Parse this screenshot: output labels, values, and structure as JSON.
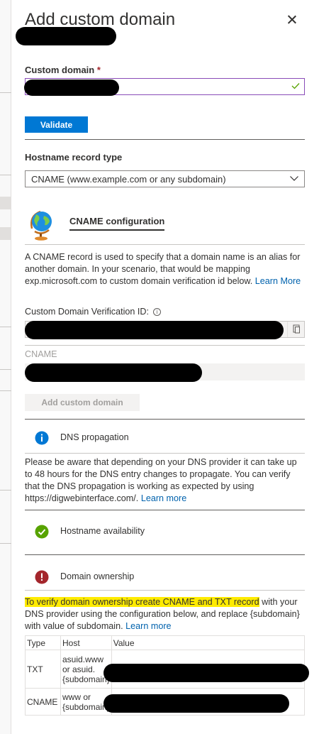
{
  "panel": {
    "title": "Add custom domain",
    "close_label": "close"
  },
  "custom_domain": {
    "label": "Custom domain",
    "required_mark": "*"
  },
  "validate_button": "Validate",
  "hostname_record": {
    "label": "Hostname record type",
    "selected": "CNAME (www.example.com or any subdomain)"
  },
  "cname_section": {
    "heading": "CNAME configuration",
    "description": "A CNAME record is used to specify that a domain name is an alias for another domain. In your scenario, that would be mapping exp.microsoft.com to custom domain verification id below.",
    "learn_more": "Learn More",
    "verification_id_label": "Custom Domain Verification ID:",
    "info_glyph": "i",
    "cname_label": "CNAME"
  },
  "add_custom_domain_button": "Add custom domain",
  "dns_propagation": {
    "title": "DNS propagation",
    "text": "Please be aware that depending on your DNS provider it can take up to 48 hours for the DNS entry changes to propagate. You can verify that the DNS propagation is working as expected by using https://digwebinterface.com/.",
    "learn_more": "Learn more"
  },
  "hostname_availability": {
    "title": "Hostname availability"
  },
  "domain_ownership": {
    "title": "Domain ownership",
    "text_highlight": "To verify domain ownership create CNAME and TXT record",
    "text_rest": " with your DNS provider using the configuration below, and replace {subdomain} with value of subdomain.",
    "learn_more": "Learn more"
  },
  "records_table": {
    "headers": [
      "Type",
      "Host",
      "Value"
    ],
    "rows": [
      {
        "type": "TXT",
        "host": "asuid.www or asuid.{subdomain}"
      },
      {
        "type": "CNAME",
        "host": "www or {subdomain}"
      }
    ]
  },
  "colors": {
    "primary": "#0078d4",
    "info": "#0078d4",
    "success": "#57a300",
    "error": "#a4262c",
    "highlight": "#ffeb00",
    "valid_border": "#8a4cb8"
  }
}
